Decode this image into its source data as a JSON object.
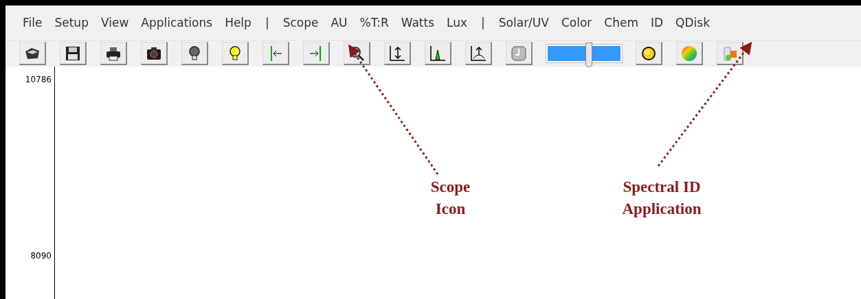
{
  "menu": [
    {
      "label": "File",
      "kind": "item"
    },
    {
      "label": "Setup",
      "kind": "item"
    },
    {
      "label": "View",
      "kind": "item"
    },
    {
      "label": "Applications",
      "kind": "item"
    },
    {
      "label": "Help",
      "kind": "item"
    },
    {
      "label": "|",
      "kind": "separator"
    },
    {
      "label": "Scope",
      "kind": "item"
    },
    {
      "label": "AU",
      "kind": "item"
    },
    {
      "label": "%T:R",
      "kind": "item"
    },
    {
      "label": "Watts",
      "kind": "item"
    },
    {
      "label": "Lux",
      "kind": "item"
    },
    {
      "label": "|",
      "kind": "separator"
    },
    {
      "label": "Solar/UV",
      "kind": "item"
    },
    {
      "label": "Color",
      "kind": "item"
    },
    {
      "label": "Chem",
      "kind": "item"
    },
    {
      "label": "ID",
      "kind": "item"
    },
    {
      "label": "QDisk",
      "kind": "item"
    }
  ],
  "toolbar": [
    {
      "kind": "open"
    },
    {
      "kind": "save"
    },
    {
      "kind": "print"
    },
    {
      "kind": "camera"
    },
    {
      "kind": "bulb-off"
    },
    {
      "kind": "bulb-on"
    },
    {
      "kind": "left-marker"
    },
    {
      "kind": "right-marker"
    },
    {
      "kind": "zoom"
    },
    {
      "kind": "scale"
    },
    {
      "kind": "peak"
    },
    {
      "kind": "peak-up"
    },
    {
      "kind": "clock"
    },
    {
      "kind": "slider",
      "level": 0.55
    },
    {
      "kind": "sun"
    },
    {
      "kind": "color-wheel"
    },
    {
      "kind": "flask"
    }
  ],
  "plot": {
    "y_labels": [
      "10786",
      "8090"
    ]
  },
  "annotations": [
    {
      "lines": [
        "Scope",
        "Icon"
      ]
    },
    {
      "lines": [
        "Spectral ID",
        "Application"
      ]
    }
  ]
}
